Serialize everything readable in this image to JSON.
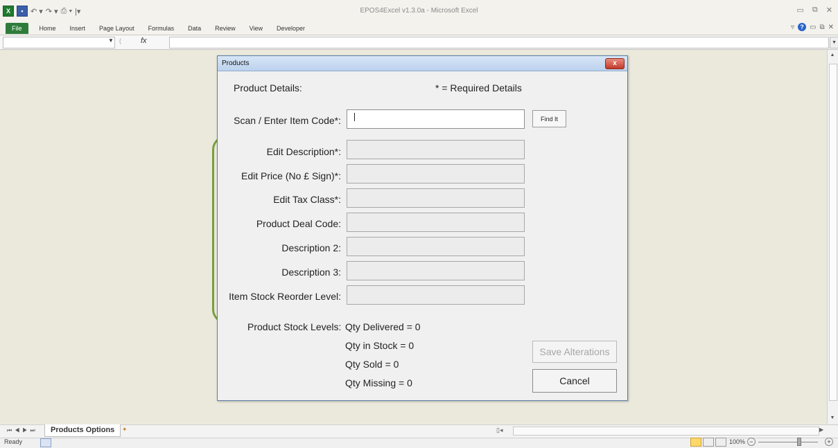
{
  "window": {
    "title": "EPOS4Excel v1.3.0a - Microsoft Excel"
  },
  "ribbon": {
    "tabs": [
      "File",
      "Home",
      "Insert",
      "Page Layout",
      "Formulas",
      "Data",
      "Review",
      "View",
      "Developer"
    ]
  },
  "formula_bar": {
    "fx_label": "fx",
    "name_box": "",
    "formula": ""
  },
  "sheet_tabs": {
    "active": "Products Options"
  },
  "status_bar": {
    "ready": "Ready",
    "zoom": "100%"
  },
  "dialog": {
    "title": "Products",
    "close_label": "x",
    "section_title": "Product Details:",
    "required_note": "* = Required Details",
    "fields": [
      {
        "label": "Scan / Enter Item Code*:",
        "value": ""
      },
      {
        "label": "Edit Description*:",
        "value": ""
      },
      {
        "label": "Edit Price (No £ Sign)*:",
        "value": ""
      },
      {
        "label": "Edit Tax Class*:",
        "value": ""
      },
      {
        "label": "Product Deal Code:",
        "value": ""
      },
      {
        "label": "Description 2:",
        "value": ""
      },
      {
        "label": "Description 3:",
        "value": ""
      },
      {
        "label": "Item Stock Reorder Level:",
        "value": ""
      }
    ],
    "find_button": "Find It",
    "stock_levels": {
      "label": "Product Stock Levels:",
      "qty_delivered": "Qty Delivered = 0",
      "qty_in_stock": "Qty in Stock = 0",
      "qty_sold": "Qty Sold = 0",
      "qty_missing": "Qty Missing = 0"
    },
    "save_button": "Save Alterations",
    "cancel_button": "Cancel"
  }
}
